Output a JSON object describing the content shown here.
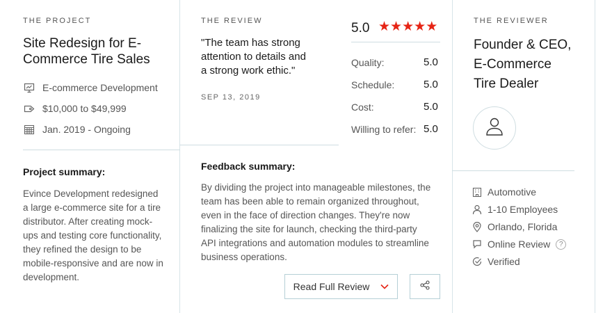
{
  "project": {
    "eyebrow": "THE PROJECT",
    "title_line1": "Site Redesign for E-",
    "title_line2": "Commerce Tire Sales",
    "service": "E-commerce Development",
    "budget": "$10,000 to $49,999",
    "dates": "Jan. 2019 - Ongoing",
    "summary_heading": "Project summary:",
    "summary_lines": [
      "Evince Development redesigned",
      "a large e-commerce site for a tire",
      "distributor. After creating mock-",
      "ups and testing core functionality,",
      "they refined the design to be",
      "mobile-responsive and are now in",
      "development."
    ],
    "icons": [
      "presentation-icon",
      "price-tag-icon",
      "calendar-icon"
    ]
  },
  "review": {
    "eyebrow": "THE REVIEW",
    "quote_lines": [
      "\"The team has strong",
      "attention to details and",
      "a strong work ethic.\""
    ],
    "date": "SEP 13, 2019",
    "overall": "5.0",
    "stars": 5,
    "scores": [
      {
        "label": "Quality:",
        "value": "5.0"
      },
      {
        "label": "Schedule:",
        "value": "5.0"
      },
      {
        "label": "Cost:",
        "value": "5.0"
      },
      {
        "label": "Willing to refer:",
        "value": "5.0"
      }
    ],
    "feedback_heading": "Feedback summary:",
    "feedback_lines": [
      "By dividing the project into manageable milestones, the",
      "team has been able to remain organized throughout,",
      "even in the face of direction changes. They're now",
      "finalizing the site for launch, checking the third-party",
      "API integrations and automation modules to streamline",
      "business operations."
    ],
    "read_full_label": "Read Full Review",
    "colors": {
      "star": "#e62415",
      "border": "#b5cfd6",
      "accent": "#e62415"
    }
  },
  "reviewer": {
    "eyebrow": "THE REVIEWER",
    "title_lines": [
      "Founder & CEO,",
      "E-Commerce",
      "Tire Dealer"
    ],
    "details": [
      {
        "icon": "building-icon",
        "text": "Automotive"
      },
      {
        "icon": "person-icon",
        "text": "1-10 Employees"
      },
      {
        "icon": "location-pin-icon",
        "text": "Orlando, Florida"
      },
      {
        "icon": "chat-bubble-icon",
        "text": "Online Review"
      },
      {
        "icon": "check-circle-icon",
        "text": "Verified"
      }
    ],
    "help_glyph": "?"
  }
}
